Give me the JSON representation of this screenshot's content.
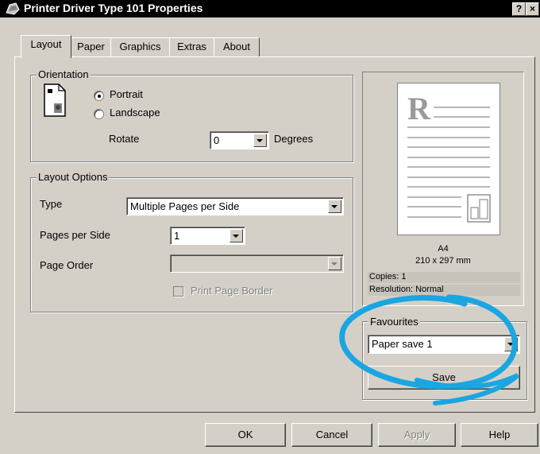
{
  "window": {
    "title": "Printer Driver Type 101 Properties",
    "help_button": "?",
    "close_button": "×"
  },
  "tabs": [
    {
      "label": "Layout",
      "active": true
    },
    {
      "label": "Paper",
      "active": false
    },
    {
      "label": "Graphics",
      "active": false
    },
    {
      "label": "Extras",
      "active": false
    },
    {
      "label": "About",
      "active": false
    }
  ],
  "orientation": {
    "legend": "Orientation",
    "portrait_label": "Portrait",
    "landscape_label": "Landscape",
    "selected": "Portrait",
    "rotate_label": "Rotate",
    "rotate_value": "0",
    "degrees_label": "Degrees"
  },
  "layout_options": {
    "legend": "Layout Options",
    "type_label": "Type",
    "type_value": "Multiple Pages per Side",
    "pages_per_side_label": "Pages per Side",
    "pages_per_side_value": "1",
    "page_order_label": "Page Order",
    "page_order_value": "",
    "print_page_border_label": "Print Page Border",
    "print_page_border_checked": false
  },
  "preview": {
    "letter": "R",
    "paper_name": "A4",
    "paper_size": "210 x 297 mm",
    "copies": "Copies: 1",
    "resolution": "Resolution: Normal"
  },
  "favourites": {
    "legend": "Favourites",
    "selected": "Paper save 1",
    "save_label": "Save"
  },
  "buttons": {
    "ok": "OK",
    "cancel": "Cancel",
    "apply": "Apply",
    "help": "Help"
  },
  "colors": {
    "dialog_face": "#d4d0c8",
    "highlight_ellipse": "#1aa6e0"
  }
}
